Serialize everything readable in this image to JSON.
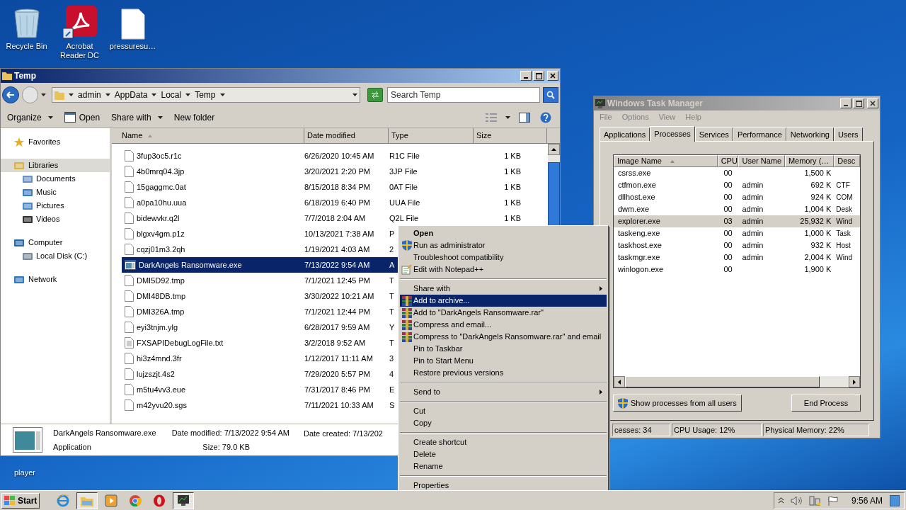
{
  "desktop_icons": [
    {
      "kind": "recycle",
      "label": "Recycle Bin"
    },
    {
      "kind": "acrobat",
      "label": "Acrobat Reader DC"
    },
    {
      "kind": "document",
      "label": "pressuresu…"
    }
  ],
  "desktop_hidden_label": "player",
  "explorer": {
    "title": "Temp",
    "breadcrumb": [
      "admin",
      "AppData",
      "Local",
      "Temp"
    ],
    "search_placeholder": "Search Temp",
    "toolbar": [
      {
        "label": "Organize",
        "kind": "menu"
      },
      {
        "label": "Open",
        "kind": "open"
      },
      {
        "label": "Share with",
        "kind": "menu"
      },
      {
        "label": "New folder",
        "kind": "plain"
      }
    ],
    "nav": [
      {
        "label": "Favorites",
        "kind": "star",
        "selected": false
      },
      {
        "label": "Libraries",
        "kind": "library",
        "selected": true,
        "children": [
          {
            "label": "Documents",
            "kind": "documents",
            "selected": false
          },
          {
            "label": "Music",
            "kind": "music",
            "selected": false
          },
          {
            "label": "Pictures",
            "kind": "pictures",
            "selected": false
          },
          {
            "label": "Videos",
            "kind": "videos",
            "selected": false
          }
        ]
      },
      {
        "label": "Computer",
        "kind": "computer",
        "selected": false,
        "children": [
          {
            "label": "Local Disk (C:)",
            "kind": "disk",
            "selected": false
          }
        ]
      },
      {
        "label": "Network",
        "kind": "network",
        "selected": false
      }
    ],
    "columns": [
      "Name",
      "Date modified",
      "Type",
      "Size"
    ],
    "rows": [
      {
        "name": "3fup3oc5.r1c",
        "date": "6/26/2020 10:45 AM",
        "type": "R1C File",
        "size": "1 KB",
        "kind": "file",
        "selected": false
      },
      {
        "name": "4b0mrq04.3jp",
        "date": "3/20/2021 2:20 PM",
        "type": "3JP File",
        "size": "1 KB",
        "kind": "file",
        "selected": false
      },
      {
        "name": "15gaggmc.0at",
        "date": "8/15/2018 8:34 PM",
        "type": "0AT File",
        "size": "1 KB",
        "kind": "file",
        "selected": false
      },
      {
        "name": "a0pa10hu.uua",
        "date": "6/18/2019 6:40 PM",
        "type": "UUA File",
        "size": "1 KB",
        "kind": "file",
        "selected": false
      },
      {
        "name": "bidewvkr.q2l",
        "date": "7/7/2018 2:04 AM",
        "type": "Q2L File",
        "size": "1 KB",
        "kind": "file",
        "selected": false
      },
      {
        "name": "blgxv4gm.p1z",
        "date": "10/13/2021 7:38 AM",
        "type": "P",
        "kind": "file",
        "selected": false
      },
      {
        "name": "cqzj01m3.2qh",
        "date": "1/19/2021 4:03 AM",
        "type": "2",
        "kind": "file",
        "selected": false
      },
      {
        "name": "DarkAngels Ransomware.exe",
        "date": "7/13/2022 9:54 AM",
        "type": "A",
        "kind": "app",
        "selected": true
      },
      {
        "name": "DMI5D92.tmp",
        "date": "7/1/2021 12:45 PM",
        "type": "T",
        "kind": "file",
        "selected": false
      },
      {
        "name": "DMI48DB.tmp",
        "date": "3/30/2022 10:21 AM",
        "type": "T",
        "kind": "file",
        "selected": false
      },
      {
        "name": "DMI326A.tmp",
        "date": "7/1/2021 12:44 PM",
        "type": "T",
        "kind": "file",
        "selected": false
      },
      {
        "name": "eyi3tnjm.ylg",
        "date": "6/28/2017 9:59 AM",
        "type": "Y",
        "kind": "file",
        "selected": false
      },
      {
        "name": "FXSAPIDebugLogFile.txt",
        "date": "3/2/2018 9:52 AM",
        "type": "T",
        "kind": "text",
        "selected": false
      },
      {
        "name": "hi3z4mnd.3fr",
        "date": "1/12/2017 11:11 AM",
        "type": "3",
        "kind": "file",
        "selected": false
      },
      {
        "name": "lujzszjt.4s2",
        "date": "7/29/2020 5:57 PM",
        "type": "4",
        "kind": "file",
        "selected": false
      },
      {
        "name": "m5tu4vv3.eue",
        "date": "7/31/2017 8:46 PM",
        "type": "E",
        "kind": "file",
        "selected": false
      },
      {
        "name": "m42yvu20.sgs",
        "date": "7/11/2021 10:33 AM",
        "type": "S",
        "kind": "file",
        "selected": false
      }
    ],
    "details": {
      "name": "DarkAngels Ransomware.exe",
      "type": "Application",
      "date_modified": "Date modified: 7/13/2022 9:54 AM",
      "size": "Size: 79.0 KB",
      "date_created": "Date created: 7/13/202"
    }
  },
  "context_menu": [
    {
      "kind": "plain",
      "label": "Open",
      "bold": true,
      "submenu": false,
      "selected": false
    },
    {
      "kind": "shield",
      "label": "Run as administrator",
      "bold": false,
      "submenu": false,
      "selected": false
    },
    {
      "kind": "plain",
      "label": "Troubleshoot compatibility",
      "bold": false,
      "submenu": false,
      "selected": false
    },
    {
      "kind": "notepad",
      "label": "Edit with Notepad++",
      "bold": false,
      "submenu": false,
      "selected": false
    },
    {
      "kind": "separator"
    },
    {
      "kind": "plain",
      "label": "Share with",
      "bold": false,
      "submenu": true,
      "selected": false
    },
    {
      "kind": "archive",
      "label": "Add to archive...",
      "bold": false,
      "submenu": false,
      "selected": true
    },
    {
      "kind": "archive",
      "label": "Add to \"DarkAngels Ransomware.rar\"",
      "bold": false,
      "submenu": false,
      "selected": false
    },
    {
      "kind": "archive",
      "label": "Compress and email...",
      "bold": false,
      "submenu": false,
      "selected": false
    },
    {
      "kind": "archive",
      "label": "Compress to \"DarkAngels Ransomware.rar\" and email",
      "bold": false,
      "submenu": false,
      "selected": false
    },
    {
      "kind": "plain",
      "label": "Pin to Taskbar",
      "bold": false,
      "submenu": false,
      "selected": false
    },
    {
      "kind": "plain",
      "label": "Pin to Start Menu",
      "bold": false,
      "submenu": false,
      "selected": false
    },
    {
      "kind": "plain",
      "label": "Restore previous versions",
      "bold": false,
      "submenu": false,
      "selected": false
    },
    {
      "kind": "separator"
    },
    {
      "kind": "plain",
      "label": "Send to",
      "bold": false,
      "submenu": true,
      "selected": false
    },
    {
      "kind": "separator"
    },
    {
      "kind": "plain",
      "label": "Cut",
      "bold": false,
      "submenu": false,
      "selected": false
    },
    {
      "kind": "plain",
      "label": "Copy",
      "bold": false,
      "submenu": false,
      "selected": false
    },
    {
      "kind": "separator"
    },
    {
      "kind": "plain",
      "label": "Create shortcut",
      "bold": false,
      "submenu": false,
      "selected": false
    },
    {
      "kind": "plain",
      "label": "Delete",
      "bold": false,
      "submenu": false,
      "selected": false
    },
    {
      "kind": "plain",
      "label": "Rename",
      "bold": false,
      "submenu": false,
      "selected": false
    },
    {
      "kind": "separator"
    },
    {
      "kind": "plain",
      "label": "Properties",
      "bold": false,
      "submenu": false,
      "selected": false
    }
  ],
  "task_manager": {
    "title": "Windows Task Manager",
    "menu": [
      "File",
      "Options",
      "View",
      "Help"
    ],
    "tabs": [
      {
        "label": "Applications",
        "selected": false
      },
      {
        "label": "Processes",
        "selected": true
      },
      {
        "label": "Services",
        "selected": false
      },
      {
        "label": "Performance",
        "selected": false
      },
      {
        "label": "Networking",
        "selected": false
      },
      {
        "label": "Users",
        "selected": false
      }
    ],
    "columns": [
      "Image Name",
      "CPU",
      "User Name",
      "Memory (…",
      "Desc"
    ],
    "rows": [
      {
        "name": "csrss.exe",
        "cpu": "00",
        "user": "",
        "memory": "1,500 K",
        "desc": "",
        "selected": false
      },
      {
        "name": "ctfmon.exe",
        "cpu": "00",
        "user": "admin",
        "memory": "692 K",
        "desc": "CTF",
        "selected": false
      },
      {
        "name": "dllhost.exe",
        "cpu": "00",
        "user": "admin",
        "memory": "924 K",
        "desc": "COM",
        "selected": false
      },
      {
        "name": "dwm.exe",
        "cpu": "00",
        "user": "admin",
        "memory": "1,004 K",
        "desc": "Desk",
        "selected": false
      },
      {
        "name": "explorer.exe",
        "cpu": "03",
        "user": "admin",
        "memory": "25,932 K",
        "desc": "Wind",
        "selected": true
      },
      {
        "name": "taskeng.exe",
        "cpu": "00",
        "user": "admin",
        "memory": "1,000 K",
        "desc": "Task",
        "selected": false
      },
      {
        "name": "taskhost.exe",
        "cpu": "00",
        "user": "admin",
        "memory": "932 K",
        "desc": "Host",
        "selected": false
      },
      {
        "name": "taskmgr.exe",
        "cpu": "00",
        "user": "admin",
        "memory": "2,004 K",
        "desc": "Wind",
        "selected": false
      },
      {
        "name": "winlogon.exe",
        "cpu": "00",
        "user": "",
        "memory": "1,900 K",
        "desc": "",
        "selected": false
      }
    ],
    "show_all_button": "Show processes from all users",
    "end_button": "End Process",
    "status": [
      "cesses: 34",
      "CPU Usage: 12%",
      "Physical Memory: 22%"
    ]
  },
  "taskbar": {
    "start": "Start",
    "apps": [
      {
        "kind": "ie",
        "active": false
      },
      {
        "kind": "explorer",
        "active": true
      },
      {
        "kind": "media",
        "active": false
      },
      {
        "kind": "chrome",
        "active": false
      },
      {
        "kind": "opera",
        "active": false
      },
      {
        "kind": "taskmgr",
        "active": true
      }
    ],
    "time": "9:56 AM"
  }
}
